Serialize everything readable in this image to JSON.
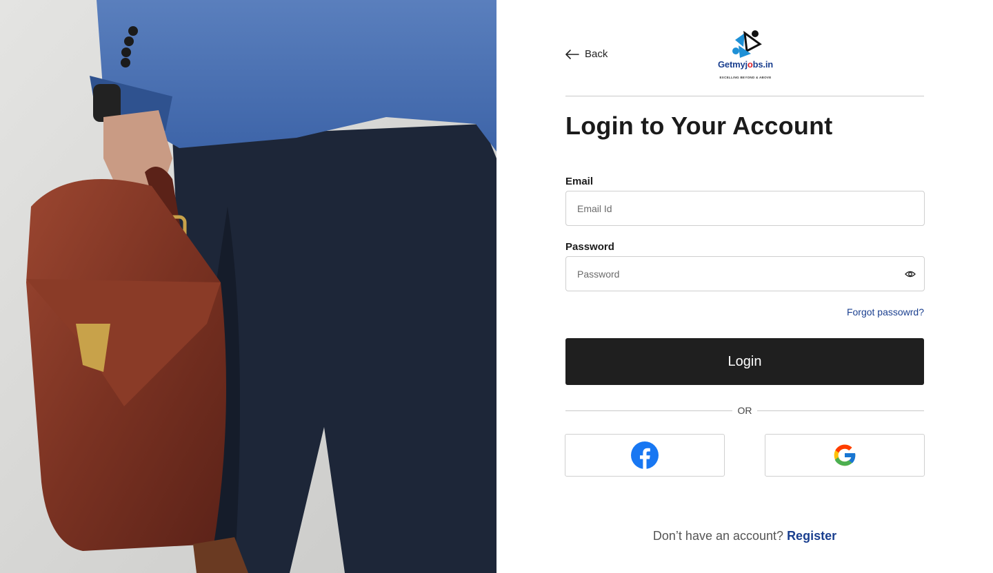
{
  "photo": {
    "alt_subject": "person-with-briefcase"
  },
  "nav": {
    "back_label": "Back"
  },
  "logo": {
    "brand_part1": "Getmyj",
    "brand_part2": "bs.in",
    "tagline": "EXCELLING BEYOND & ABOVE"
  },
  "form": {
    "title": "Login to Your Account",
    "email_label": "Email",
    "email_placeholder": "Email Id",
    "email_value": "",
    "password_label": "Password",
    "password_placeholder": "Password",
    "password_value": "",
    "forgot_label": "Forgot passowrd?",
    "login_label": "Login",
    "or_label": "OR"
  },
  "social": {
    "facebook_icon": "facebook-icon",
    "google_icon": "google-icon"
  },
  "footer": {
    "prompt": "Don’t have an account?",
    "register_label": "Register"
  },
  "colors": {
    "accent": "#1a3f8f",
    "button_bg": "#1f1f1f",
    "facebook": "#1877f2"
  }
}
